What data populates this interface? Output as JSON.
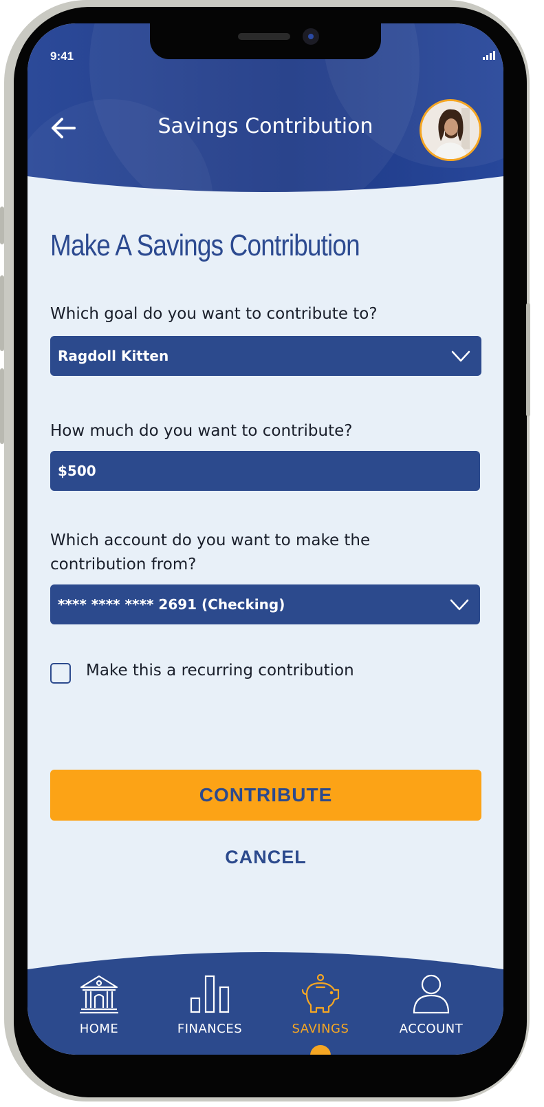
{
  "status_bar": {
    "time": "9:41"
  },
  "header": {
    "title": "Savings Contribution"
  },
  "page": {
    "title": "Make A Savings Contribution"
  },
  "form": {
    "goal": {
      "label": "Which goal do you want to contribute to?",
      "value": "Ragdoll Kitten"
    },
    "amount": {
      "label": "How much do you want to contribute?",
      "value": "$500"
    },
    "account": {
      "label_line1": "Which account do you want to make the",
      "label_line2": "contribution from?",
      "value": "**** **** **** 2691 (Checking)"
    },
    "recurring": {
      "label": "Make this a recurring contribution",
      "checked": false
    }
  },
  "actions": {
    "contribute": "CONTRIBUTE",
    "cancel": "CANCEL"
  },
  "nav": {
    "items": [
      {
        "label": "HOME",
        "icon": "bank-icon"
      },
      {
        "label": "FINANCES",
        "icon": "bar-chart-icon"
      },
      {
        "label": "SAVINGS",
        "icon": "piggy-bank-icon"
      },
      {
        "label": "ACCOUNT",
        "icon": "user-icon"
      }
    ],
    "active": "SAVINGS"
  },
  "colors": {
    "primary": "#2c4a8d",
    "accent": "#fca316",
    "background": "#e8f0f8"
  }
}
